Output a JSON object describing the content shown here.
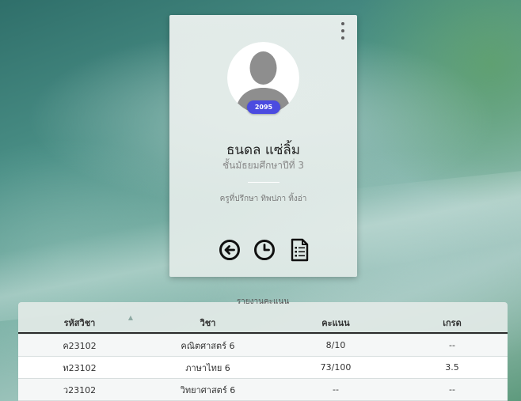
{
  "profile": {
    "student_id": "2095",
    "name": "ธนดล แซ่ลิ้ม",
    "level": "ชั้นมัธยมศึกษาปีที่ 3",
    "advisor": "ครูที่ปรึกษา ทิพปภา ทิ้งอ่า",
    "icons": [
      "back-arrow-icon",
      "clock-icon",
      "document-list-icon"
    ],
    "menu_icon": "kebab-menu-icon",
    "id_badge_color": "#4b4be0"
  },
  "report": {
    "title": "รายงานคะแนน",
    "headers": [
      "รหัสวิชา",
      "วิชา",
      "คะแนน",
      "เกรด"
    ],
    "rows": [
      [
        "ค23102",
        "คณิตศาสตร์ 6",
        "8/10",
        "--"
      ],
      [
        "ท23102",
        "ภาษาไทย 6",
        "73/100",
        "3.5"
      ],
      [
        "ว23102",
        "วิทยาศาสตร์ 6",
        "--",
        "--"
      ]
    ]
  }
}
